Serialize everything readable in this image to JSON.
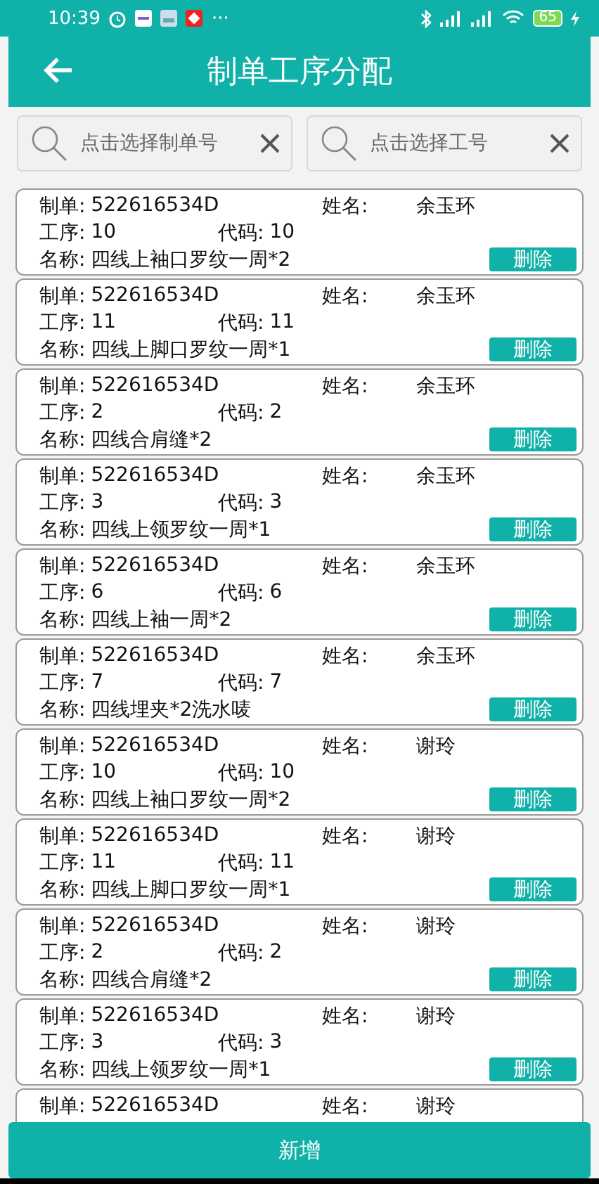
{
  "status_bar": {
    "time": "10:39",
    "more": "···",
    "battery": "65"
  },
  "header": {
    "title": "制单工序分配"
  },
  "search": [
    {
      "placeholder": "点击选择制单号"
    },
    {
      "placeholder": "点击选择工号"
    }
  ],
  "cards": [
    {
      "order_label": "制单:",
      "order": "522616534D",
      "name_label": "姓名:",
      "name": "余玉环",
      "step_label": "工序:",
      "step": "10",
      "code_label": "代码:",
      "code": "10",
      "title_label": "名称:",
      "title": "四线上袖口罗纹一周*2",
      "delete": "删除"
    },
    {
      "order_label": "制单:",
      "order": "522616534D",
      "name_label": "姓名:",
      "name": "余玉环",
      "step_label": "工序:",
      "step": "11",
      "code_label": "代码:",
      "code": "11",
      "title_label": "名称:",
      "title": "四线上脚口罗纹一周*1",
      "delete": "删除"
    },
    {
      "order_label": "制单:",
      "order": "522616534D",
      "name_label": "姓名:",
      "name": "余玉环",
      "step_label": "工序:",
      "step": "2",
      "code_label": "代码:",
      "code": "2",
      "title_label": "名称:",
      "title": "四线合肩缝*2",
      "delete": "删除"
    },
    {
      "order_label": "制单:",
      "order": "522616534D",
      "name_label": "姓名:",
      "name": "余玉环",
      "step_label": "工序:",
      "step": "3",
      "code_label": "代码:",
      "code": "3",
      "title_label": "名称:",
      "title": "四线上领罗纹一周*1",
      "delete": "删除"
    },
    {
      "order_label": "制单:",
      "order": "522616534D",
      "name_label": "姓名:",
      "name": "余玉环",
      "step_label": "工序:",
      "step": "6",
      "code_label": "代码:",
      "code": "6",
      "title_label": "名称:",
      "title": "四线上袖一周*2",
      "delete": "删除"
    },
    {
      "order_label": "制单:",
      "order": "522616534D",
      "name_label": "姓名:",
      "name": "余玉环",
      "step_label": "工序:",
      "step": "7",
      "code_label": "代码:",
      "code": "7",
      "title_label": "名称:",
      "title": "四线埋夹*2洗水唛",
      "delete": "删除"
    },
    {
      "order_label": "制单:",
      "order": "522616534D",
      "name_label": "姓名:",
      "name": "谢玲",
      "step_label": "工序:",
      "step": "10",
      "code_label": "代码:",
      "code": "10",
      "title_label": "名称:",
      "title": "四线上袖口罗纹一周*2",
      "delete": "删除"
    },
    {
      "order_label": "制单:",
      "order": "522616534D",
      "name_label": "姓名:",
      "name": "谢玲",
      "step_label": "工序:",
      "step": "11",
      "code_label": "代码:",
      "code": "11",
      "title_label": "名称:",
      "title": "四线上脚口罗纹一周*1",
      "delete": "删除"
    },
    {
      "order_label": "制单:",
      "order": "522616534D",
      "name_label": "姓名:",
      "name": "谢玲",
      "step_label": "工序:",
      "step": "2",
      "code_label": "代码:",
      "code": "2",
      "title_label": "名称:",
      "title": "四线合肩缝*2",
      "delete": "删除"
    },
    {
      "order_label": "制单:",
      "order": "522616534D",
      "name_label": "姓名:",
      "name": "谢玲",
      "step_label": "工序:",
      "step": "3",
      "code_label": "代码:",
      "code": "3",
      "title_label": "名称:",
      "title": "四线上领罗纹一周*1",
      "delete": "删除"
    },
    {
      "order_label": "制单:",
      "order": "522616534D",
      "name_label": "姓名:",
      "name": "谢玲"
    }
  ],
  "add_button": "新增"
}
